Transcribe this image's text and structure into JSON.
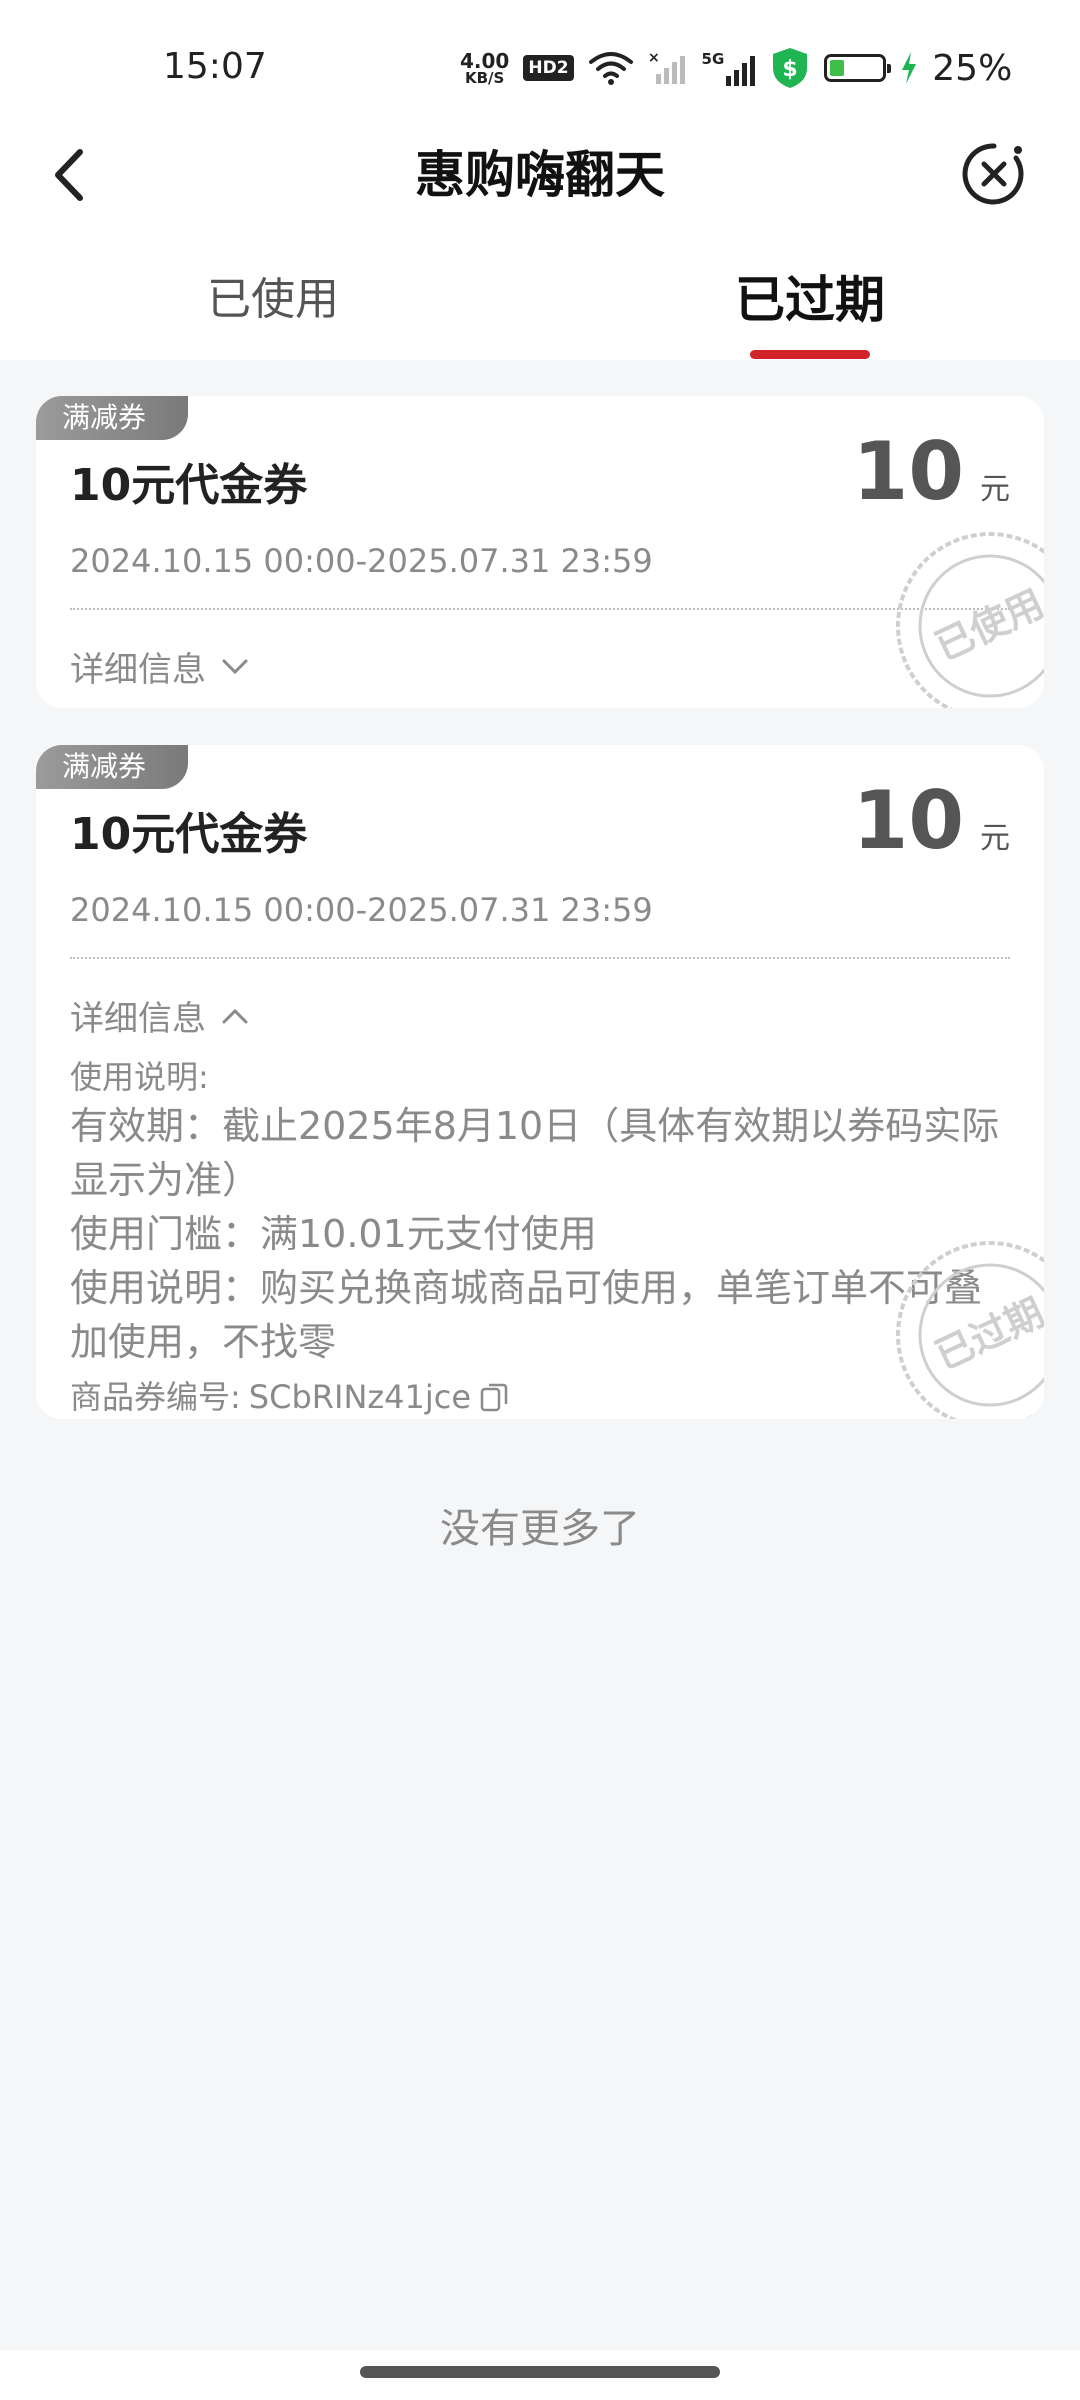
{
  "status_bar": {
    "time": "15:07",
    "net_speed_value": "4.00",
    "net_speed_unit": "KB/S",
    "hd_badge": "HD2",
    "signal_label": "5G",
    "battery_percent": "25%",
    "icons": [
      "wifi-icon",
      "no-signal-icon",
      "5g-signal-icon",
      "shield-dollar-icon",
      "battery-icon",
      "charging-icon"
    ]
  },
  "nav": {
    "title": "惠购嗨翻天",
    "back_icon": "chevron-left-icon",
    "close_icon": "close-circle-icon"
  },
  "tabs": [
    {
      "label": "已使用",
      "active": false
    },
    {
      "label": "已过期",
      "active": true
    }
  ],
  "coupons": [
    {
      "tag": "满减券",
      "name": "10元代金券",
      "amount": "10",
      "unit": "元",
      "validity": "2024.10.15 00:00-2025.07.31 23:59",
      "detail_label": "详细信息",
      "expanded": false,
      "stamp": "已使用"
    },
    {
      "tag": "满减券",
      "name": "10元代金券",
      "amount": "10",
      "unit": "元",
      "validity": "2024.10.15 00:00-2025.07.31 23:59",
      "detail_label": "详细信息",
      "expanded": true,
      "usage_header": "使用说明:",
      "rules": [
        "有效期：截止2025年8月10日（具体有效期以券码实际显示为准）",
        "使用门槛：满10.01元支付使用",
        "使用说明：购买兑换商城商品可使用，单笔订单不可叠加使用，不找零"
      ],
      "code_label": "商品券编号:",
      "code_value": "SCbRINz41jce",
      "stamp": "已过期"
    }
  ],
  "footer_text": "没有更多了",
  "colors": {
    "accent": "#d2232a",
    "background": "#f5f6f8",
    "tag_gray": "#8c8c8c",
    "muted_text": "#8a8a8a"
  }
}
